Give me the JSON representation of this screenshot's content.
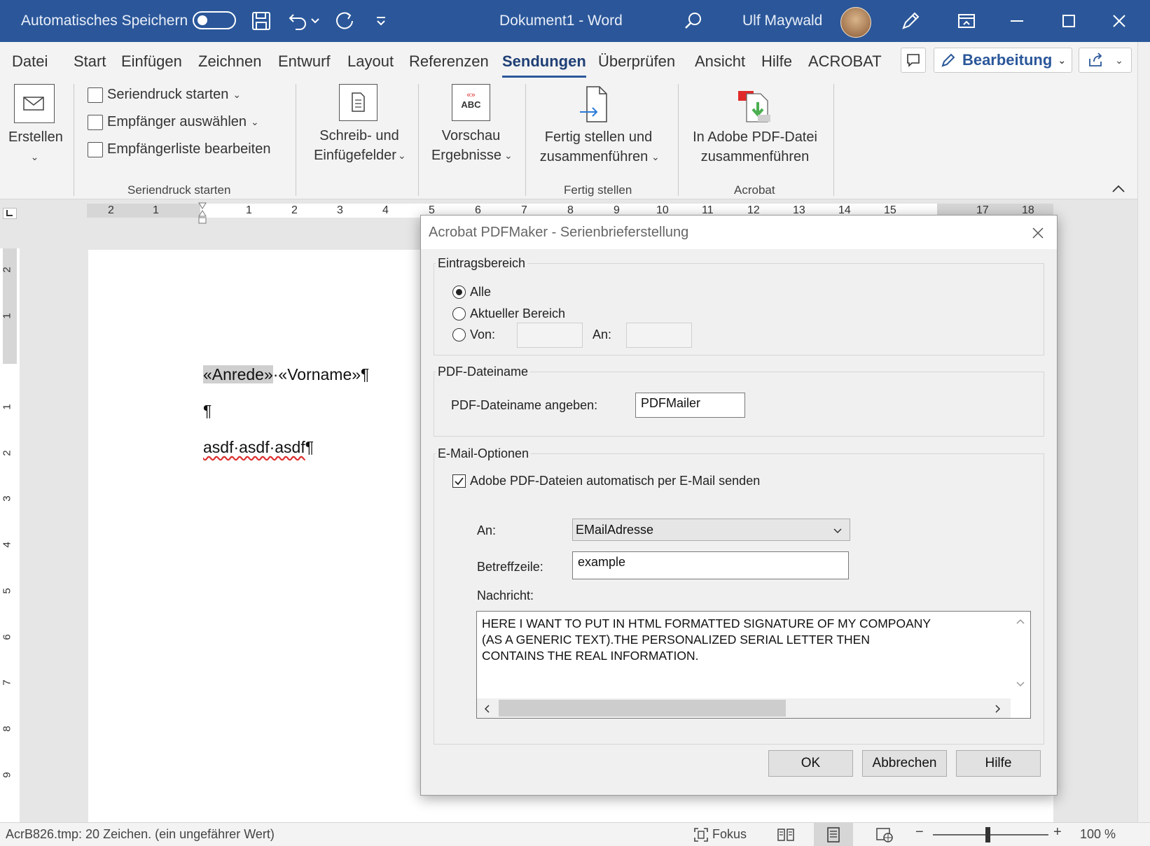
{
  "titlebar": {
    "autosave_label": "Automatisches Speichern",
    "doc_title": "Dokument1  -  Word",
    "user_name": "Ulf Maywald",
    "icons": [
      "save-icon",
      "undo-icon",
      "redo-icon",
      "customize-icon",
      "search-icon",
      "pen-icon",
      "ribbon-display-icon",
      "minimize-icon",
      "maximize-icon",
      "close-icon"
    ]
  },
  "tabs": [
    "Datei",
    "Start",
    "Einfügen",
    "Zeichnen",
    "Entwurf",
    "Layout",
    "Referenzen",
    "Sendungen",
    "Überprüfen",
    "Ansicht",
    "Hilfe",
    "ACROBAT"
  ],
  "active_tab": "Sendungen",
  "tab_right": {
    "editing_label": "Bearbeitung"
  },
  "ribbon": {
    "create_label": "Erstellen",
    "mailmerge_start": "Seriendruck starten",
    "select_recipients": "Empfänger auswählen",
    "edit_recipients": "Empfängerliste bearbeiten",
    "group_mailmerge": "Seriendruck starten",
    "write_insert_1": "Schreib- und",
    "write_insert_2": "Einfügefelder",
    "preview_1": "Vorschau",
    "preview_2": "Ergebnisse",
    "finish_1": "Fertig stellen und",
    "finish_2": "zusammenführen",
    "group_finish": "Fertig stellen",
    "adobe_1": "In Adobe PDF-Datei",
    "adobe_2": "zusammenführen",
    "group_acrobat": "Acrobat",
    "abc_icon_text": "ABC"
  },
  "ruler": {
    "top_numbers": [
      "2",
      "1",
      "1",
      "2",
      "3",
      "4",
      "5",
      "6",
      "7",
      "8",
      "9",
      "10",
      "11",
      "12",
      "13",
      "14",
      "15",
      "17",
      "18"
    ],
    "left_numbers": [
      "2",
      "1",
      "1",
      "2",
      "3",
      "4",
      "5",
      "6",
      "7",
      "8",
      "9"
    ]
  },
  "document": {
    "line1_selected": "«Anrede»",
    "line1_rest": "·«Vorname»¶",
    "line2": "¶",
    "line3_text": "asdf·asdf·asdf",
    "line3_mark": "¶"
  },
  "dialog": {
    "title": "Acrobat PDFMaker - Serienbrieferstellung",
    "range": {
      "title": "Eintragsbereich",
      "all": "Alle",
      "current": "Aktueller Bereich",
      "from": "Von:",
      "to": "An:",
      "selected": "Alle"
    },
    "pdfname": {
      "title": "PDF-Dateiname",
      "label": "PDF-Dateiname angeben:",
      "value": "PDFMailer"
    },
    "email": {
      "title": "E-Mail-Optionen",
      "auto_send_label": "Adobe PDF-Dateien automatisch per E-Mail senden",
      "auto_send_checked": true,
      "to_label": "An:",
      "to_value": "EMailAdresse",
      "subject_label": "Betreffzeile:",
      "subject_value": "example",
      "message_label": "Nachricht:",
      "message_value": "HERE I WANT TO PUT IN HTML FORMATTED SIGNATURE OF MY COMPOANY\n(AS A GENERIC TEXT).THE PERSONALIZED SERIAL LETTER THEN\nCONTAINS THE REAL INFORMATION."
    },
    "buttons": {
      "ok": "OK",
      "cancel": "Abbrechen",
      "help": "Hilfe"
    }
  },
  "statusbar": {
    "info": "AcrB826.tmp: 20 Zeichen. (ein ungefährer Wert)",
    "focus": "Fokus",
    "zoom": "100 %",
    "zoom_level": 1.0
  },
  "colors": {
    "titlebar": "#2b579a",
    "ribbon": "#f3f3f3",
    "dialog_bg": "#f0f0f0",
    "acrobat_red": "#e02a2a",
    "acrobat_green": "#4caf50"
  }
}
